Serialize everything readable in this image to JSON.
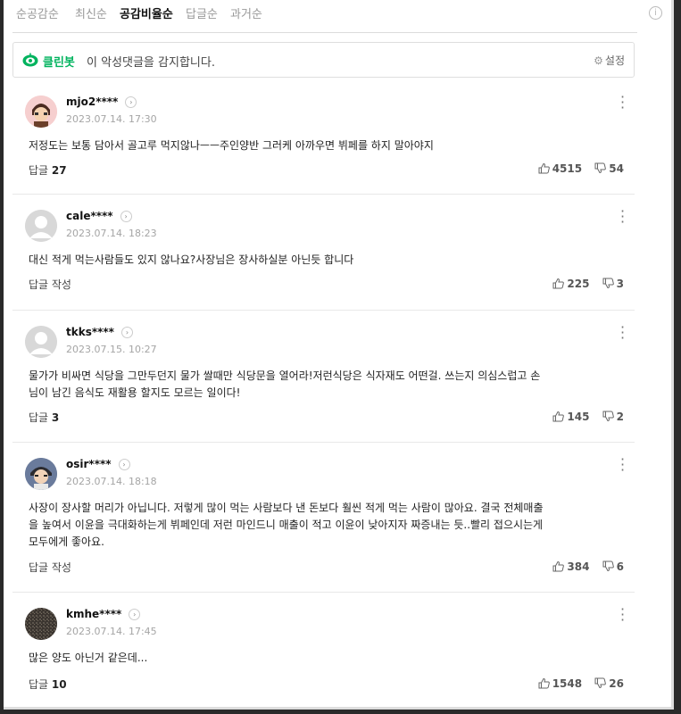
{
  "sort": {
    "items": [
      "순공감순",
      "최신순",
      "공감비율순",
      "답글순",
      "과거순"
    ],
    "active_index": 2,
    "info_icon": "info-icon"
  },
  "cleanbot": {
    "name": "클린봇",
    "text": "이 악성댓글을 감지합니다.",
    "settings_label": "설정",
    "brand_color": "#00b35e"
  },
  "comments": [
    {
      "user": "mjo2****",
      "date": "2023.07.14. 17:30",
      "lines": [
        "저정도는 보통 담아서 골고루 먹지않나ㅡㅡ주인양반 그러케 아까우면 뷔페를 하지 말아야지"
      ],
      "reply_label": "답글",
      "reply_count": "27",
      "likes": "4515",
      "dislikes": "54"
    },
    {
      "user": "cale****",
      "date": "2023.07.14. 18:23",
      "lines": [
        "대신 적게 먹는사람들도 있지 않나요?사장님은 장사하실분 아닌듯 합니다"
      ],
      "reply_label": "답글 작성",
      "reply_count": "",
      "likes": "225",
      "dislikes": "3"
    },
    {
      "user": "tkks****",
      "date": "2023.07.15. 10:27",
      "lines": [
        "물가가 비싸면 식당을 그만두던지 물가 쌀때만 식당문을 열어라!저런식당은 식자재도 어떤걸. 쓰는지 의심스럽고 손",
        "님이 남긴 음식도 재활용 할지도 모르는 일이다!"
      ],
      "reply_label": "답글",
      "reply_count": "3",
      "likes": "145",
      "dislikes": "2"
    },
    {
      "user": "osir****",
      "date": "2023.07.14. 18:18",
      "lines": [
        "사장이 장사할 머리가 아닙니다. 저렇게 많이 먹는 사람보다 낸 돈보다 훨씬 적게 먹는 사람이 많아요. 결국 전체매출",
        "을 높여서 이윤을 극대화하는게 뷔페인데 저런 마인드니 매출이 적고 이윤이 낮아지자 짜증내는 듯..빨리 접으시는게",
        "모두에게 좋아요."
      ],
      "reply_label": "답글 작성",
      "reply_count": "",
      "likes": "384",
      "dislikes": "6"
    },
    {
      "user": "kmhe****",
      "date": "2023.07.14. 17:45",
      "lines": [
        "많은 양도 아닌거 같은데..."
      ],
      "reply_label": "답글",
      "reply_count": "10",
      "likes": "1548",
      "dislikes": "26"
    }
  ]
}
